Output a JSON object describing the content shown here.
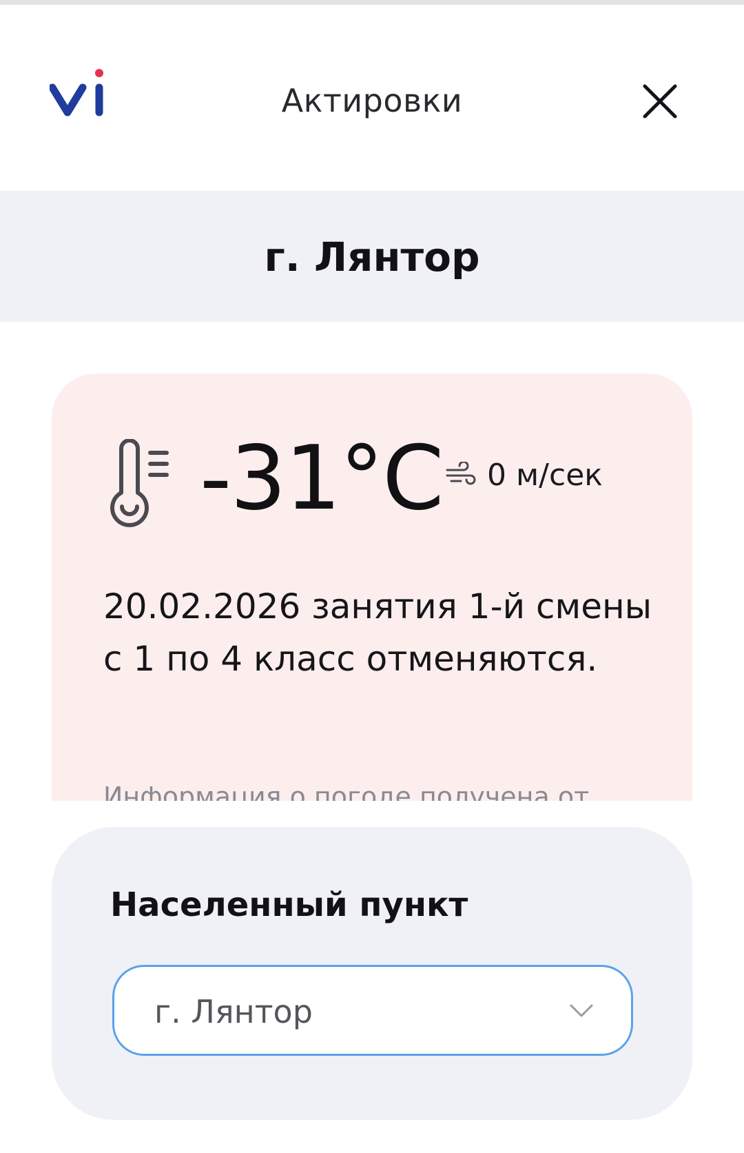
{
  "header": {
    "title": "Актировки"
  },
  "city": {
    "name": "г. Лянтор"
  },
  "weather": {
    "temperature": "-31°C",
    "wind": "0 м/сек",
    "message": "20.02.2026 занятия 1-й смены с 1 по 4 класс отменяются.",
    "source_note": "Информация о погоде получена от"
  },
  "settlement": {
    "label": "Населенный пункт",
    "selected": "г. Лянтор"
  },
  "colors": {
    "brand_blue": "#1f3c9e",
    "brand_red": "#e4334a",
    "alert_bg": "#fdeeee",
    "panel_bg": "#f0f1f7",
    "focus_border": "#5aa2ea"
  }
}
